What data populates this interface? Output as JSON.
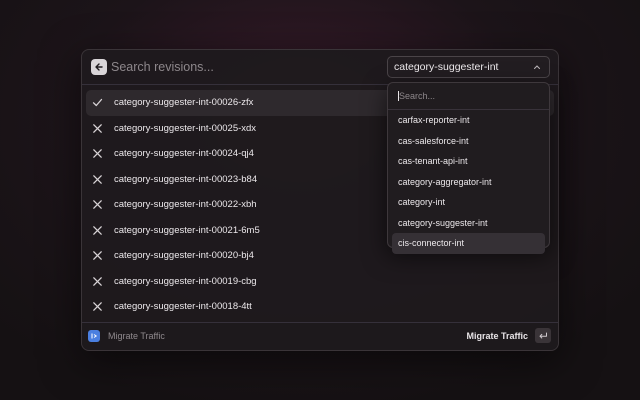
{
  "search": {
    "placeholder": "Search revisions..."
  },
  "service_select": {
    "value": "category-suggester-int"
  },
  "revisions": [
    {
      "name": "category-suggester-int-00026-zfx",
      "icon": "check-icon"
    },
    {
      "name": "category-suggester-int-00025-xdx",
      "icon": "x-icon"
    },
    {
      "name": "category-suggester-int-00024-qj4",
      "icon": "x-icon"
    },
    {
      "name": "category-suggester-int-00023-b84",
      "icon": "x-icon"
    },
    {
      "name": "category-suggester-int-00022-xbh",
      "icon": "x-icon"
    },
    {
      "name": "category-suggester-int-00021-6m5",
      "icon": "x-icon"
    },
    {
      "name": "category-suggester-int-00020-bj4",
      "icon": "x-icon"
    },
    {
      "name": "category-suggester-int-00019-cbg",
      "icon": "x-icon"
    },
    {
      "name": "category-suggester-int-00018-4tt",
      "icon": "x-icon"
    }
  ],
  "dropdown": {
    "search_placeholder": "Search...",
    "options": [
      "carfax-reporter-int",
      "cas-salesforce-int",
      "cas-tenant-api-int",
      "category-aggregator-int",
      "category-int",
      "category-suggester-int",
      "cis-connector-int"
    ]
  },
  "footer": {
    "app_name": "Migrate Traffic",
    "action_label": "Migrate Traffic"
  },
  "colors": {
    "accent": "#4a7fe0",
    "selected_row": "#2e292d",
    "highlight": "#353035"
  }
}
